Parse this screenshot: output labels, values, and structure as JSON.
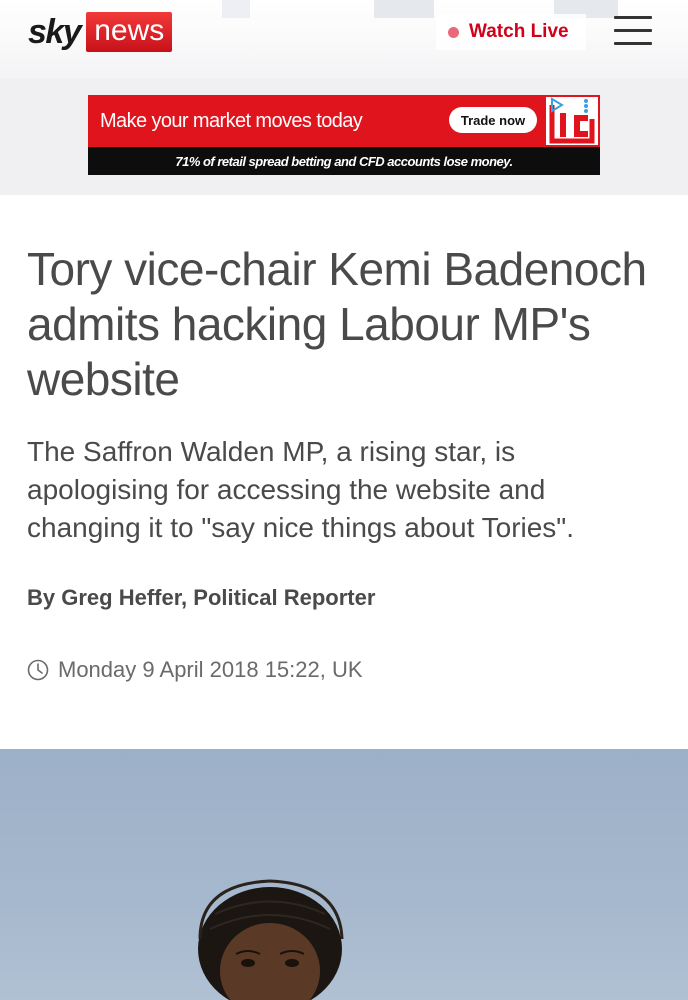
{
  "header": {
    "logo": {
      "brand": "sky",
      "product": "news"
    },
    "watch_live": {
      "label": "Watch Live",
      "dot_color": "#e86a7a",
      "text_color": "#d0021b"
    },
    "menu_icon": "hamburger-menu-icon"
  },
  "ad": {
    "headline": "Make your market moves today",
    "cta": "Trade now",
    "disclaimer": "71% of retail spread betting and CFD accounts lose money.",
    "logo_text": "IG",
    "colors": {
      "top": "#e0141d",
      "bottom": "#0d0d0d"
    }
  },
  "article": {
    "headline": "Tory vice-chair Kemi Badenoch admits hacking Labour MP's website",
    "standfirst": "The Saffron Walden MP, a rising star, is apologising for accessing the website and changing it to \"say nice things about Tories\".",
    "byline": "By Greg Heffer, Political Reporter",
    "timestamp": "Monday 9 April 2018 15:22, UK",
    "timestamp_icon": "clock-icon"
  },
  "photo": {
    "subject": "portrait-photo"
  }
}
